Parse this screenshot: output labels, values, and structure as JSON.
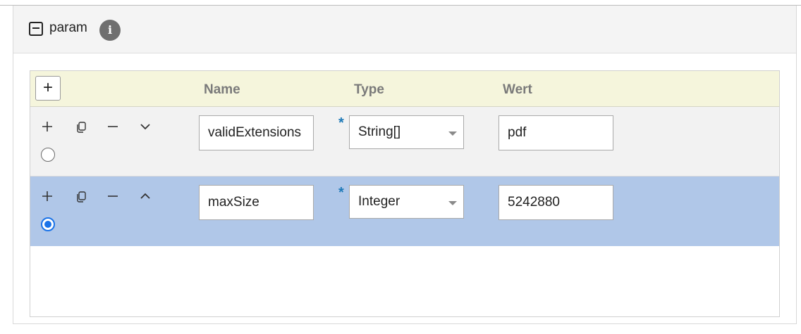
{
  "panel": {
    "title": "param",
    "info_icon_glyph": "i"
  },
  "table": {
    "add_row_glyph": "+",
    "columns": [
      "Name",
      "Type",
      "Wert"
    ],
    "rows": [
      {
        "name": "validExtensions",
        "type": "String[]",
        "value": "pdf",
        "selected": false,
        "move_direction": "down"
      },
      {
        "name": "maxSize",
        "type": "Integer",
        "value": "5242880",
        "selected": true,
        "move_direction": "up"
      }
    ],
    "required_mark": "*"
  },
  "colors": {
    "header_bg": "#f5f5dc",
    "selected_row_bg": "#b0c7e8",
    "required_star": "#1f7ab8",
    "radio_selected": "#1a73e8"
  }
}
